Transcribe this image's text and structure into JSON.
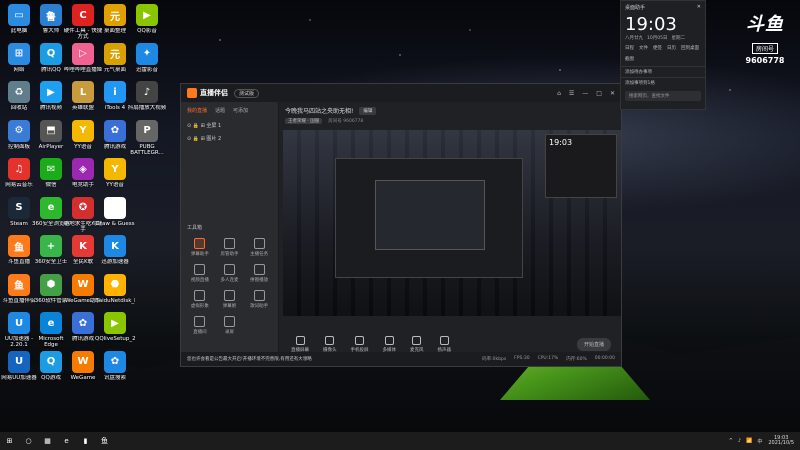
{
  "desktop": {
    "icons": [
      {
        "label": "此电脑",
        "glyph": "▭",
        "color": "#2a8be0",
        "col": 0,
        "row": 0
      },
      {
        "label": "鲁大师",
        "glyph": "鲁",
        "color": "#2a7fd0",
        "col": 1,
        "row": 0
      },
      {
        "label": "硬件工具 - 快捷方式",
        "glyph": "C",
        "color": "#d22",
        "col": 2,
        "row": 0
      },
      {
        "label": "桌面整理",
        "glyph": "元",
        "color": "#e0a000",
        "col": 3,
        "row": 0
      },
      {
        "label": "QQ影音",
        "glyph": "▶",
        "color": "#8ac600",
        "col": 4,
        "row": 0
      },
      {
        "label": "网络",
        "glyph": "⊞",
        "color": "#2a8be0",
        "col": 0,
        "row": 1
      },
      {
        "label": "腾讯QQ",
        "glyph": "Q",
        "color": "#1d9ce6",
        "col": 1,
        "row": 1
      },
      {
        "label": "哔哩哔哩直播姬",
        "glyph": "▷",
        "color": "#f06292",
        "col": 2,
        "row": 1
      },
      {
        "label": "元气桌面",
        "glyph": "元",
        "color": "#d8a000",
        "col": 3,
        "row": 1
      },
      {
        "label": "迅雷影音",
        "glyph": "✦",
        "color": "#1e88e5",
        "col": 4,
        "row": 1
      },
      {
        "label": "回收站",
        "glyph": "♻",
        "color": "#607d8b",
        "col": 0,
        "row": 2
      },
      {
        "label": "腾讯视频",
        "glyph": "▶",
        "color": "#1ea0f0",
        "col": 1,
        "row": 2
      },
      {
        "label": "英雄联盟",
        "glyph": "L",
        "color": "#c89b3c",
        "col": 2,
        "row": 2
      },
      {
        "label": "iTools 4",
        "glyph": "i",
        "color": "#2196f3",
        "col": 3,
        "row": 2
      },
      {
        "label": "抖扇播放大视频",
        "glyph": "♪",
        "color": "#444",
        "col": 4,
        "row": 2
      },
      {
        "label": "控制面板",
        "glyph": "⚙",
        "color": "#3a7bd5",
        "col": 0,
        "row": 3
      },
      {
        "label": "AirPlayer",
        "glyph": "⬒",
        "color": "#555",
        "col": 1,
        "row": 3
      },
      {
        "label": "YY语音",
        "glyph": "Y",
        "color": "#f5b800",
        "col": 2,
        "row": 3
      },
      {
        "label": "腾讯游戏",
        "glyph": "✿",
        "color": "#3a6fd8",
        "col": 3,
        "row": 3
      },
      {
        "label": "PUBG BATTLEGR...",
        "glyph": "P",
        "color": "#666",
        "col": 4,
        "row": 3
      },
      {
        "label": "网易云音乐",
        "glyph": "♫",
        "color": "#e5322d",
        "col": 0,
        "row": 4
      },
      {
        "label": "微信",
        "glyph": "✉",
        "color": "#1aad19",
        "col": 1,
        "row": 4
      },
      {
        "label": "电竞助手",
        "glyph": "◈",
        "color": "#9c27b0",
        "col": 2,
        "row": 4
      },
      {
        "label": "YY语音",
        "glyph": "Y",
        "color": "#f5b800",
        "col": 3,
        "row": 4
      },
      {
        "label": "Steam",
        "glyph": "S",
        "color": "#1b2838",
        "col": 0,
        "row": 5
      },
      {
        "label": "360安全浏览器",
        "glyph": "e",
        "color": "#2eb82e",
        "col": 1,
        "row": 5
      },
      {
        "label": "绝地求生吃鸡助手",
        "glyph": "✪",
        "color": "#d32f2f",
        "col": 2,
        "row": 5
      },
      {
        "label": "Draw & Guess",
        "glyph": "✎",
        "color": "#fff",
        "col": 3,
        "row": 5
      },
      {
        "label": "斗鱼直播",
        "glyph": "鱼",
        "color": "#ff7a1a",
        "col": 0,
        "row": 6
      },
      {
        "label": "360安全卫士",
        "glyph": "+",
        "color": "#39b54a",
        "col": 1,
        "row": 6
      },
      {
        "label": "全民K歌",
        "glyph": "K",
        "color": "#e53935",
        "col": 2,
        "row": 6
      },
      {
        "label": "迅游加速器",
        "glyph": "K",
        "color": "#1e88e5",
        "col": 3,
        "row": 6
      },
      {
        "label": "斗鱼直播伴侣",
        "glyph": "鱼",
        "color": "#ff7a1a",
        "col": 0,
        "row": 7
      },
      {
        "label": "360软件管家",
        "glyph": "⬢",
        "color": "#43a047",
        "col": 1,
        "row": 7
      },
      {
        "label": "WeGame助手",
        "glyph": "W",
        "color": "#f57c00",
        "col": 2,
        "row": 7
      },
      {
        "label": "BaiduNetdisk_bdjmj2_7...",
        "glyph": "⬣",
        "color": "#ffb300",
        "col": 3,
        "row": 7
      },
      {
        "label": "UU加速器 - 2.20.1",
        "glyph": "U",
        "color": "#1e88e5",
        "col": 0,
        "row": 8
      },
      {
        "label": "Microsoft Edge",
        "glyph": "e",
        "color": "#0a84d8",
        "col": 1,
        "row": 8
      },
      {
        "label": "腾讯游戏",
        "glyph": "✿",
        "color": "#3a6fd8",
        "col": 2,
        "row": 8
      },
      {
        "label": "QQliveSetup_20_758",
        "glyph": "▶",
        "color": "#8ac600",
        "col": 3,
        "row": 8
      },
      {
        "label": "网易UU加速器",
        "glyph": "U",
        "color": "#1565c0",
        "col": 0,
        "row": 9
      },
      {
        "label": "QQ游戏",
        "glyph": "Q",
        "color": "#1d9ce6",
        "col": 1,
        "row": 9
      },
      {
        "label": "WeGame",
        "glyph": "W",
        "color": "#f57c00",
        "col": 2,
        "row": 9
      },
      {
        "label": "讯盘搜索",
        "glyph": "✿",
        "color": "#1e88e5",
        "col": 3,
        "row": 9
      }
    ]
  },
  "app": {
    "logo": "直播伴侣",
    "version": "测试版",
    "title_icons": [
      "⌂",
      "☰",
      "—",
      "□",
      "✕"
    ],
    "scene_tabs": [
      "我的直播",
      "话题",
      "可添加"
    ],
    "scenes": [
      "⊙ 🔒 ⊞ 全屏 1",
      "⊙ 🔒 ⊞ 图片 2"
    ],
    "tools_title": "工具箱",
    "tools": [
      "弹幕助手",
      "房管助手",
      "主播任务",
      "视频直播",
      "多人连麦",
      "拼图播放",
      "虚拟形象",
      "弹幕姬",
      "歌词助手",
      "直播间",
      "录屏"
    ],
    "topic_title": "今晚我马四站之央助无相!",
    "topic_edit": "编辑",
    "topic_tag": "王者荣耀 · 国服",
    "topic_room": "房间号 9606778",
    "preview_time": "19:03",
    "bottom_tools": [
      "直播屏幕",
      "摄像头",
      "手机投屏",
      "多媒体",
      "麦克风",
      "扬声器"
    ],
    "start_button": "开始直播",
    "notice": "您也许会看是公告最大开启!开播环境不完善限,有用还有大领略",
    "stats": [
      "码率:0kbps",
      "FPS:30",
      "CPU:17%",
      "内存:60%",
      "00:00:00"
    ]
  },
  "widget": {
    "header": "桌面助手",
    "time": "19:03",
    "date": [
      "八月廿九",
      "10月05日",
      "星期二"
    ],
    "buttons": [
      "日程",
      "文件",
      "便签",
      "日历",
      "回到桌面",
      "截图"
    ],
    "todo1": "添加待办事项",
    "todo2": "添加事项到1格",
    "search": "搜索网页、查找文件"
  },
  "room": {
    "logo": "斗鱼",
    "label": "房间号",
    "number": "9606778"
  },
  "taskbar": {
    "icons": [
      "⊞",
      "○",
      "▦",
      "e",
      "▮",
      "鱼"
    ],
    "tray": [
      "^",
      "♪",
      "📶",
      "中"
    ],
    "time": "19:03",
    "date": "2021/10/5"
  }
}
